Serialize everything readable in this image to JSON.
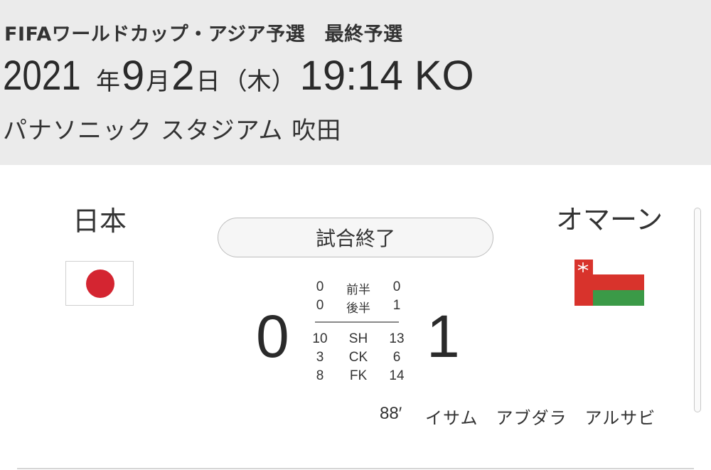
{
  "header": {
    "competition": "FIFAワールドカップ・アジア予選　最終予選",
    "date": {
      "year": "2021",
      "year_unit": "年",
      "month": "9",
      "month_unit": "月",
      "day": "2",
      "day_unit": "日",
      "weekday": "（木）",
      "kickoff": "19:14 KO"
    },
    "venue": "パナソニック スタジアム 吹田"
  },
  "match": {
    "status": "試合終了",
    "home": {
      "name": "日本",
      "score": "0",
      "flag_colors": [
        "#ffffff",
        "#d42531"
      ]
    },
    "away": {
      "name": "オマーン",
      "score": "1",
      "flag_colors": [
        "#d8332c",
        "#ffffff",
        "#3b9a47"
      ]
    },
    "half_scores": [
      {
        "home": "0",
        "label": "前半",
        "away": "0"
      },
      {
        "home": "0",
        "label": "後半",
        "away": "1"
      }
    ],
    "stats": [
      {
        "home": "10",
        "label": "SH",
        "away": "13"
      },
      {
        "home": "3",
        "label": "CK",
        "away": "6"
      },
      {
        "home": "8",
        "label": "FK",
        "away": "14"
      }
    ],
    "goals": [
      {
        "minute": "88′",
        "player": "イサム　アブダラ　アルサビ"
      }
    ]
  }
}
